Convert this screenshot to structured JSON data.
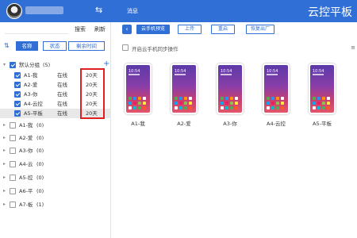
{
  "left_panel": {
    "search_placeholder": "",
    "search_label": "搜索",
    "refresh_label": "刷新",
    "sort_tabs": [
      {
        "label": "名称",
        "active": true
      },
      {
        "label": "状态",
        "active": false
      },
      {
        "label": "剩余时间",
        "active": false
      }
    ],
    "default_group": {
      "label": "默认分组",
      "count": "(5)",
      "checked": true
    },
    "devices": [
      {
        "name": "A1-我",
        "status": "在线",
        "days": "20天",
        "checked": true,
        "selected": false
      },
      {
        "name": "A2-爱",
        "status": "在线",
        "days": "20天",
        "checked": true,
        "selected": false
      },
      {
        "name": "A3-你",
        "status": "在线",
        "days": "20天",
        "checked": true,
        "selected": false
      },
      {
        "name": "A4-云控",
        "status": "在线",
        "days": "20天",
        "checked": true,
        "selected": false
      },
      {
        "name": "A5-平板",
        "status": "在线",
        "days": "20天",
        "checked": true,
        "selected": true
      }
    ],
    "groups": [
      {
        "label": "A1-我",
        "count": "(0)"
      },
      {
        "label": "A2-爱",
        "count": "(0)"
      },
      {
        "label": "A3-你",
        "count": "(0)"
      },
      {
        "label": "A4-云",
        "count": "(0)"
      },
      {
        "label": "A5-控",
        "count": "(0)"
      },
      {
        "label": "A6-平",
        "count": "(0)"
      },
      {
        "label": "A7-板",
        "count": "(1)"
      }
    ]
  },
  "right_panel": {
    "header_title": "消息",
    "brand": "云控平板",
    "toolbar": {
      "preview_label": "云手机预览",
      "upload_label": "上传",
      "reboot_label": "重启",
      "factory_reset_label": "恢复出厂"
    },
    "sync_label": "开启云手机同步操作",
    "phones": [
      {
        "label": "A1-我",
        "clock": "10:54"
      },
      {
        "label": "A2-爱",
        "clock": "10:54"
      },
      {
        "label": "A3-你",
        "clock": "10:54"
      },
      {
        "label": "A4-云控",
        "clock": "10:54"
      },
      {
        "label": "A5-平板",
        "clock": "10:54"
      }
    ]
  },
  "colors": {
    "primary": "#2f6fd6",
    "highlight_box": "#e02020"
  }
}
